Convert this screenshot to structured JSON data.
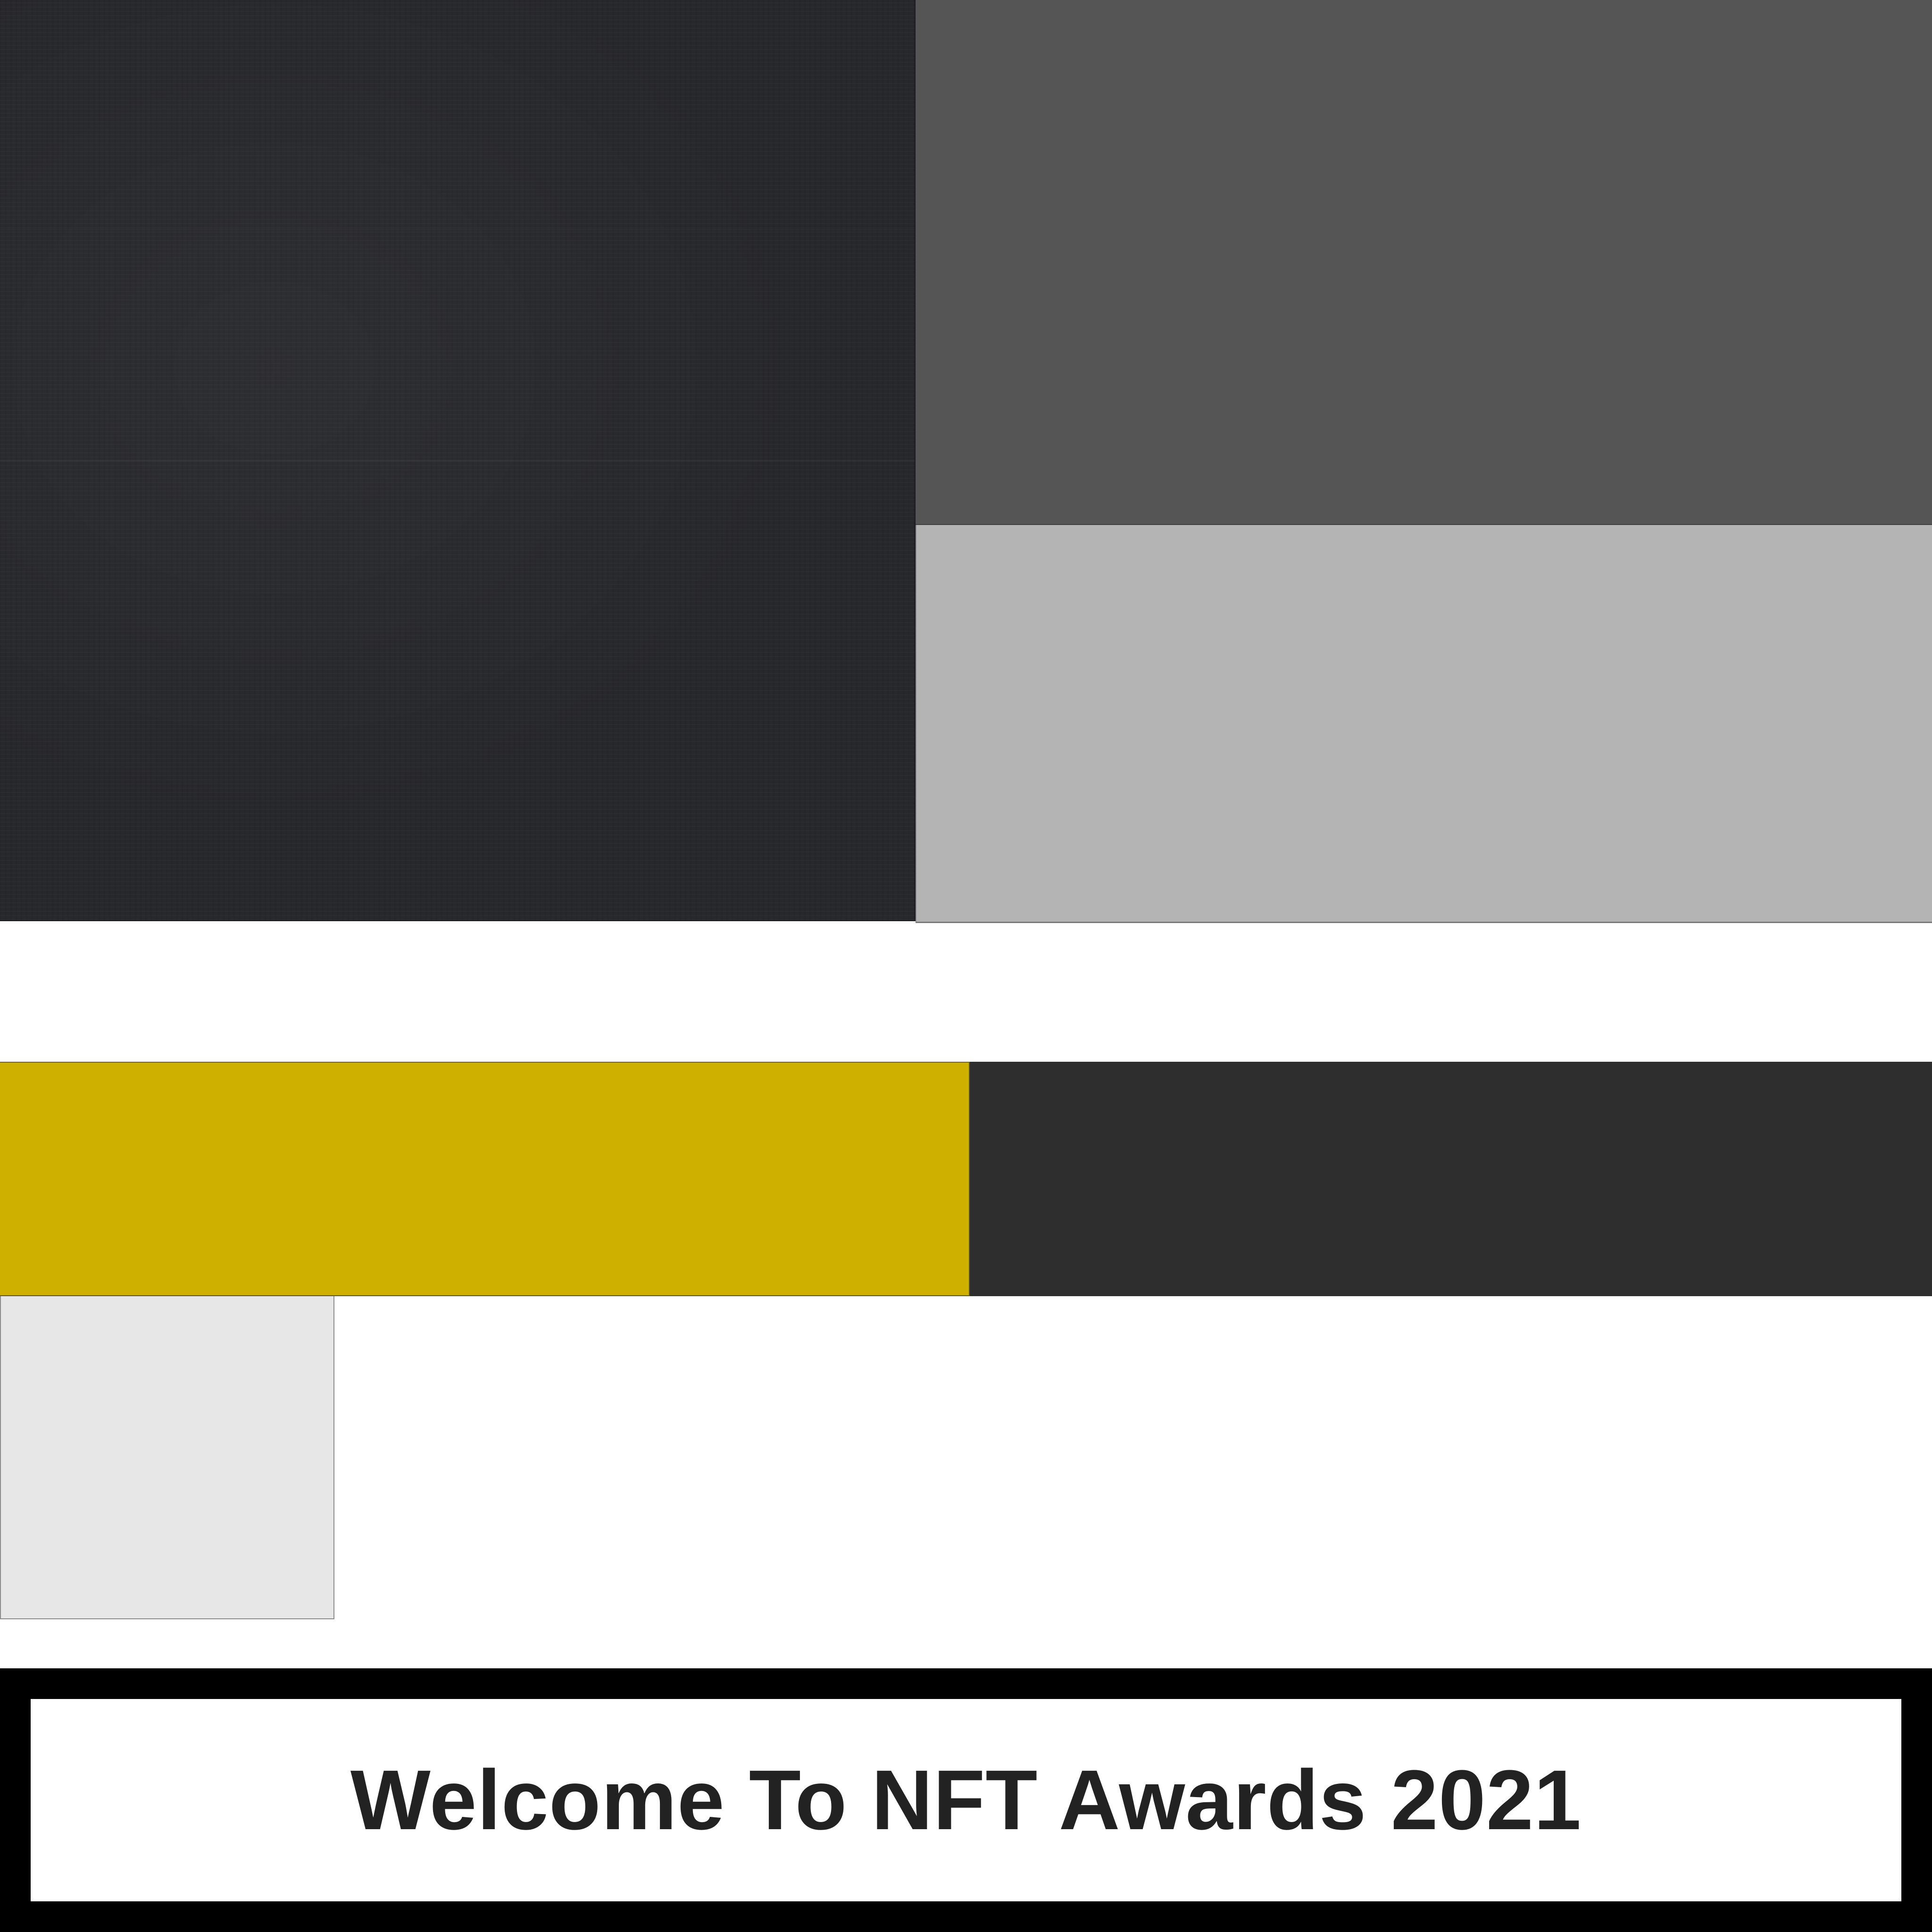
{
  "banner": {
    "title": "Welcome To NFT Awards 2021"
  },
  "colors": {
    "hero_dark": "#27282c",
    "panel_mid_gray": "#555555",
    "panel_light_gray": "#b4b4b4",
    "bar_gold": "#ceb001",
    "bar_charcoal": "#2e2e2e",
    "tile_light": "#e7e7e7",
    "banner_frame": "#000000",
    "banner_text": "#222222",
    "background": "#ffffff"
  }
}
